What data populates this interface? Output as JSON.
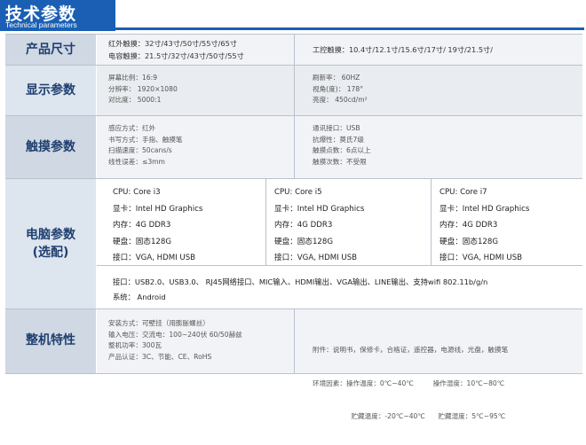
{
  "header": {
    "title": "技术参数",
    "subtitle": "Technical parameters"
  },
  "size": {
    "label": "产品尺寸",
    "ir": "红外触摸：32寸/43寸/50寸/55寸/65寸",
    "cap": "电容触摸：21.5寸/32寸/43寸/50寸/55寸",
    "industrial": "工控触摸：10.4寸/12.1寸/15.6寸/17寸/ 19寸/21.5寸/"
  },
  "display": {
    "label": "显示参数",
    "left": [
      "屏幕比例：16:9",
      "分辨率：  1920×1080",
      "对比度：  5000:1"
    ],
    "right": [
      "刷新率：  60HZ",
      "视角(度)：  178°",
      "亮度：    450cd/m²"
    ]
  },
  "touch": {
    "label": "触摸参数",
    "left": [
      "感应方式：红外",
      "书写方式：手指、触摸笔",
      "扫描速度：50cans/s",
      "线性误差：≤3mm"
    ],
    "right": [
      "通讯接口：USB",
      "抗爆性：莫氏7级",
      "触摸点数：6点以上",
      "触摸次数：不受限"
    ]
  },
  "pc": {
    "label_line1": "电脑参数",
    "label_line2": "(选配)",
    "cols": [
      [
        "CPU:  Core i3",
        "显卡：Intel HD Graphics",
        "内存：4G DDR3",
        "硬盘：固态128G",
        "接口：VGA, HDMI USB"
      ],
      [
        "CPU:  Core i5",
        "显卡：Intel HD Graphics",
        "内存：4G DDR3",
        "硬盘：固态128G",
        "接口：VGA, HDMI USB"
      ],
      [
        "CPU:  Core i7",
        "显卡：Intel HD Graphics",
        "内存：4G DDR3",
        "硬盘：固态128G",
        "接口：VGA, HDMI USB"
      ]
    ],
    "interfaces": "接口：USB2.0、USB3.0、 RJ45网络接口、MIC输入、HDMI输出、VGA输出、LINE输出、支持wifi 802.11b/g/n",
    "os": "系统：  Android"
  },
  "machine": {
    "label": "整机特性",
    "left": [
      "安装方式：可壁挂（用膨胀螺丝）",
      "输入电压：交流电：100~240伏 60/50赫兹",
      "整机功率：300瓦",
      "产品认证：3C、节能、CE、RoHS"
    ],
    "right": [
      "附件：说明书，保修卡，合格证，遥控器，电源线，光盘，触摸笔",
      "环境因素：操作温度：0℃~40℃         操作湿度：10℃~80℃",
      "                  贮藏温度：-20℃~40℃      贮藏湿度：5℃~95℃"
    ]
  }
}
